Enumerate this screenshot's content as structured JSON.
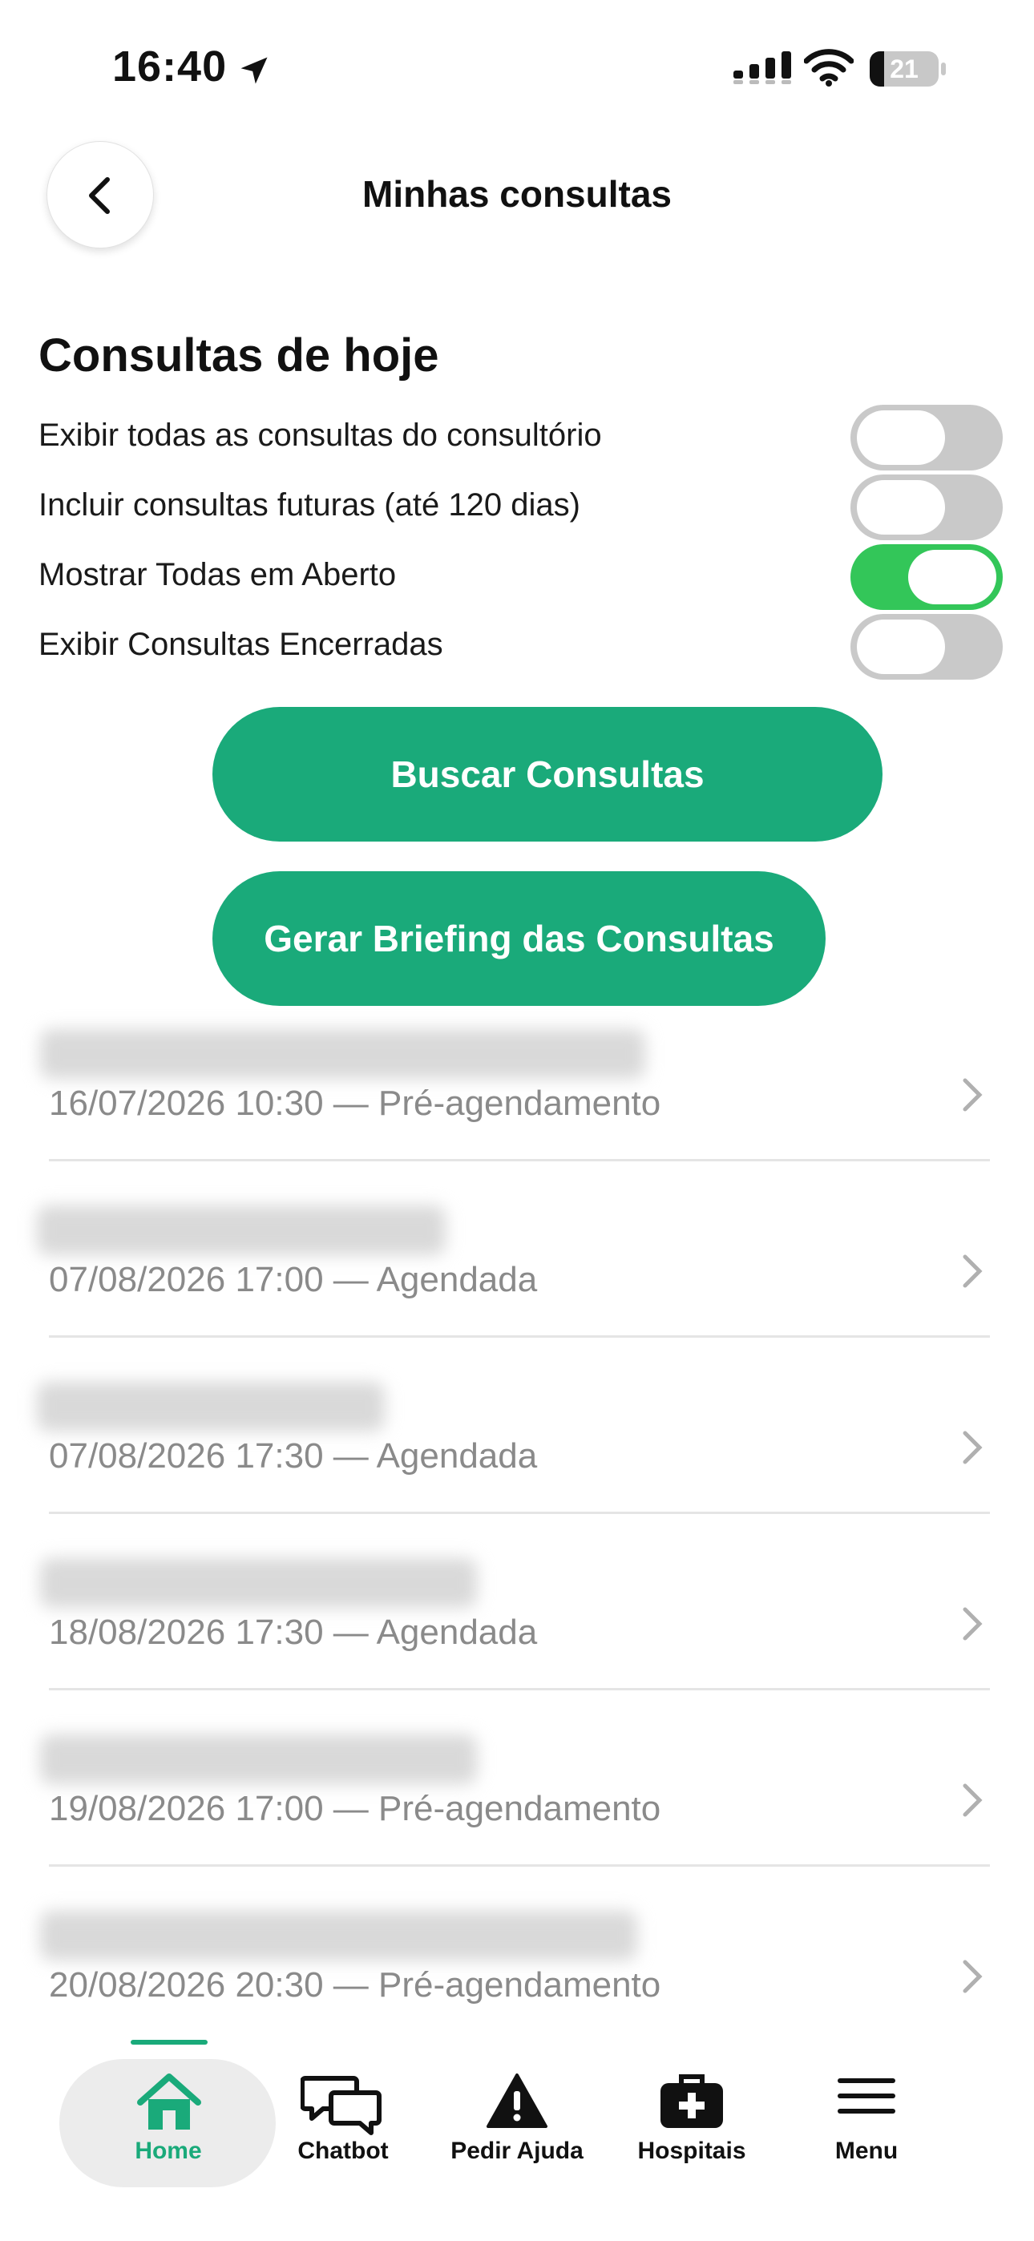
{
  "status_bar": {
    "time": "16:40",
    "battery_level": "21",
    "battery_fraction": 0.21,
    "icons": [
      "location-arrow-icon",
      "cellular-signal-icon",
      "wifi-icon",
      "battery-icon"
    ]
  },
  "header": {
    "title": "Minhas consultas",
    "back_icon": "chevron-left-icon"
  },
  "section": {
    "title": "Consultas de hoje"
  },
  "toggles": [
    {
      "label": "Exibir todas as consultas do consultório",
      "on": false
    },
    {
      "label": "Incluir consultas futuras (até 120 dias)",
      "on": false
    },
    {
      "label": "Mostrar Todas em Aberto",
      "on": true
    },
    {
      "label": "Exibir Consultas Encerradas",
      "on": false
    }
  ],
  "buttons": {
    "search_label": "Buscar Consultas",
    "briefing_label": "Gerar Briefing das Consultas"
  },
  "appointments": [
    {
      "name_hidden": true,
      "meta": "16/07/2026 10:30 — Pré-agendamento"
    },
    {
      "name_hidden": true,
      "meta": "07/08/2026 17:00 — Agendada"
    },
    {
      "name_hidden": true,
      "meta": "07/08/2026 17:30 — Agendada"
    },
    {
      "name_hidden": true,
      "meta": "18/08/2026 17:30 — Agendada"
    },
    {
      "name_hidden": true,
      "meta": "19/08/2026 17:00 — Pré-agendamento"
    },
    {
      "name_hidden": true,
      "meta": "20/08/2026 20:30 — Pré-agendamento"
    }
  ],
  "tabs": [
    {
      "label": "Home",
      "icon": "home-icon",
      "active": true
    },
    {
      "label": "Chatbot",
      "icon": "chat-bubbles-icon",
      "active": false
    },
    {
      "label": "Pedir Ajuda",
      "icon": "warning-triangle-icon",
      "active": false
    },
    {
      "label": "Hospitais",
      "icon": "medical-kit-icon",
      "active": false
    },
    {
      "label": "Menu",
      "icon": "hamburger-menu-icon",
      "active": false
    }
  ],
  "colors": {
    "accent_green": "#1aaa7a",
    "toggle_on": "#33c659",
    "toggle_off": "#c9c9c9",
    "meta_text": "#8a8a8a"
  }
}
